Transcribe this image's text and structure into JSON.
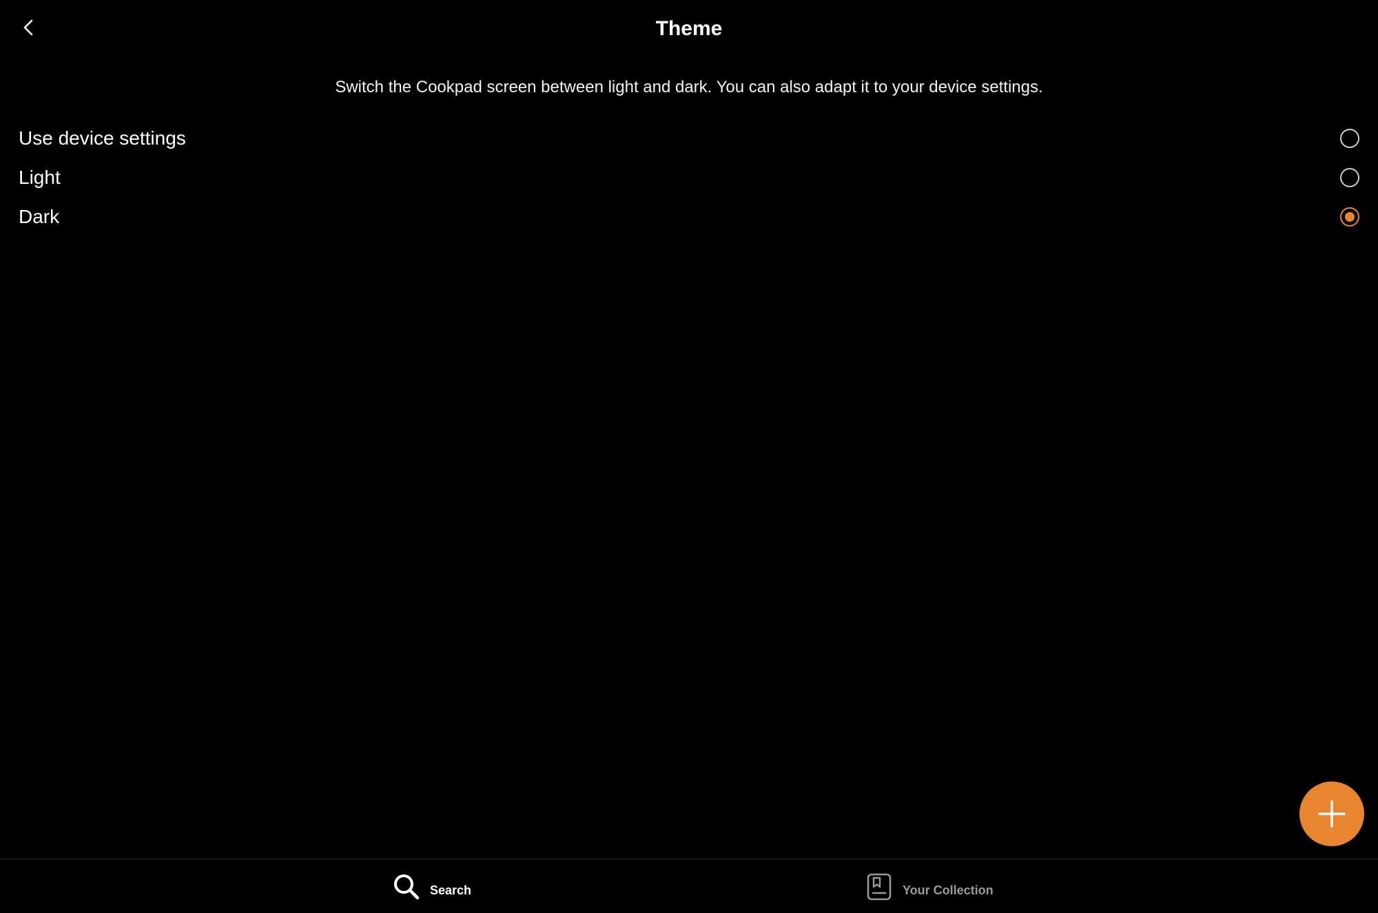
{
  "header": {
    "title": "Theme",
    "back_icon": "chevron-left-icon"
  },
  "description": "Switch the Cookpad screen between light and dark. You can also adapt it to your device settings.",
  "theme_options": [
    {
      "label": "Use device settings",
      "selected": false
    },
    {
      "label": "Light",
      "selected": false
    },
    {
      "label": "Dark",
      "selected": true
    }
  ],
  "fab": {
    "icon": "plus-icon"
  },
  "bottom_nav": {
    "search_label": "Search",
    "search_icon": "search-icon",
    "collection_label": "Your Collection",
    "collection_icon": "bookmark-book-icon",
    "active": "Search"
  },
  "colors": {
    "background": "#000000",
    "accent": "#e8852e",
    "text_primary": "#ffffff",
    "text_inactive": "#9a9a9a"
  }
}
